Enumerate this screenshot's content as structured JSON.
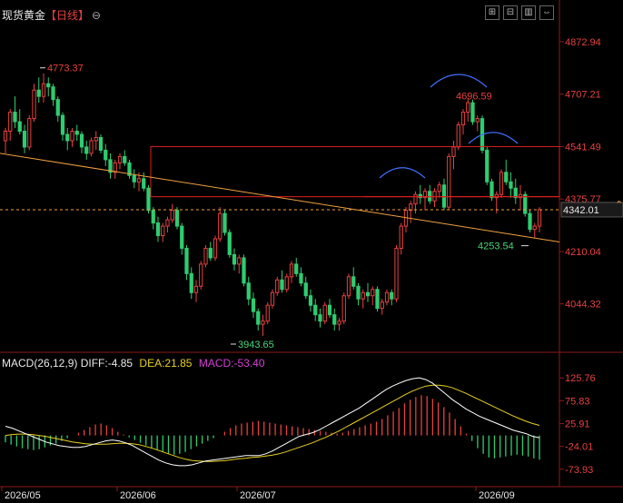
{
  "header": {
    "title": "现货黄金",
    "period": "【日线】",
    "circle_symbol": "⊖",
    "toolbar_icons": [
      "grid-plus-icon",
      "grid-minus-icon",
      "chart-split-icon",
      "arrows-icon"
    ]
  },
  "price_axis": {
    "ticks": [
      4872.94,
      4707.21,
      4541.49,
      4375.77,
      4210.04,
      4044.32
    ],
    "current_price": "4342.01",
    "range": [
      3900,
      4930
    ]
  },
  "annotations": {
    "high_left": "4773.37",
    "high_right": "4696.59",
    "low": "3943.65",
    "low_right": "4253.54"
  },
  "macd": {
    "label": "MACD(26,12,9)",
    "diff_label": "DIFF:-4.85",
    "dea_label": "DEA:21.85",
    "macd_label": "MACD:-53.40",
    "ticks": [
      "125.76",
      "75.83",
      "25.91",
      "-24.01",
      "-73.93"
    ],
    "tick_values": [
      125.76,
      75.83,
      25.91,
      -24.01,
      -73.93
    ],
    "range": [
      -100,
      150
    ]
  },
  "x_axis": {
    "labels": [
      "2026/05",
      "2026/06",
      "2026/07",
      "2026/09"
    ]
  },
  "colors": {
    "up": "#e84040",
    "down": "#2ecc71",
    "trendline": "#f0a040",
    "level_line": "#e02020",
    "arc": "#4070ff",
    "dea": "#e8d020",
    "diff": "#ffffff"
  },
  "chart_data": {
    "type": "candlestick",
    "title": "现货黄金【日线】",
    "y_range": [
      3900,
      4930
    ],
    "candles_ohlc": [
      [
        4560,
        4600,
        4520,
        4590
      ],
      [
        4590,
        4660,
        4560,
        4650
      ],
      [
        4650,
        4700,
        4600,
        4620
      ],
      [
        4620,
        4660,
        4580,
        4590
      ],
      [
        4590,
        4610,
        4520,
        4540
      ],
      [
        4540,
        4640,
        4530,
        4630
      ],
      [
        4630,
        4740,
        4620,
        4720
      ],
      [
        4720,
        4760,
        4680,
        4700
      ],
      [
        4700,
        4773,
        4680,
        4740
      ],
      [
        4740,
        4760,
        4700,
        4730
      ],
      [
        4730,
        4740,
        4670,
        4690
      ],
      [
        4690,
        4700,
        4620,
        4640
      ],
      [
        4640,
        4650,
        4560,
        4580
      ],
      [
        4580,
        4600,
        4530,
        4560
      ],
      [
        4560,
        4600,
        4540,
        4590
      ],
      [
        4590,
        4610,
        4560,
        4580
      ],
      [
        4580,
        4590,
        4520,
        4540
      ],
      [
        4540,
        4560,
        4500,
        4520
      ],
      [
        4520,
        4570,
        4510,
        4560
      ],
      [
        4560,
        4590,
        4530,
        4570
      ],
      [
        4570,
        4580,
        4520,
        4530
      ],
      [
        4530,
        4550,
        4480,
        4500
      ],
      [
        4500,
        4520,
        4440,
        4460
      ],
      [
        4460,
        4500,
        4440,
        4490
      ],
      [
        4490,
        4520,
        4470,
        4510
      ],
      [
        4510,
        4530,
        4480,
        4490
      ],
      [
        4490,
        4500,
        4440,
        4450
      ],
      [
        4450,
        4470,
        4410,
        4430
      ],
      [
        4430,
        4460,
        4400,
        4440
      ],
      [
        4440,
        4460,
        4400,
        4410
      ],
      [
        4410,
        4420,
        4330,
        4340
      ],
      [
        4340,
        4350,
        4280,
        4300
      ],
      [
        4300,
        4320,
        4240,
        4260
      ],
      [
        4260,
        4300,
        4240,
        4290
      ],
      [
        4290,
        4320,
        4270,
        4310
      ],
      [
        4310,
        4360,
        4300,
        4340
      ],
      [
        4340,
        4350,
        4280,
        4290
      ],
      [
        4290,
        4300,
        4200,
        4220
      ],
      [
        4220,
        4230,
        4120,
        4140
      ],
      [
        4140,
        4160,
        4060,
        4080
      ],
      [
        4080,
        4120,
        4050,
        4100
      ],
      [
        4100,
        4180,
        4090,
        4170
      ],
      [
        4170,
        4230,
        4160,
        4220
      ],
      [
        4220,
        4240,
        4180,
        4190
      ],
      [
        4190,
        4260,
        4180,
        4250
      ],
      [
        4250,
        4350,
        4240,
        4330
      ],
      [
        4330,
        4340,
        4260,
        4270
      ],
      [
        4270,
        4280,
        4190,
        4200
      ],
      [
        4200,
        4220,
        4150,
        4170
      ],
      [
        4170,
        4200,
        4140,
        4190
      ],
      [
        4190,
        4200,
        4100,
        4110
      ],
      [
        4110,
        4130,
        4040,
        4060
      ],
      [
        4060,
        4080,
        4000,
        4020
      ],
      [
        4020,
        4030,
        3960,
        3980
      ],
      [
        3980,
        4010,
        3943,
        3990
      ],
      [
        3990,
        4050,
        3980,
        4040
      ],
      [
        4040,
        4090,
        4030,
        4080
      ],
      [
        4080,
        4130,
        4070,
        4120
      ],
      [
        4120,
        4150,
        4080,
        4090
      ],
      [
        4090,
        4140,
        4080,
        4130
      ],
      [
        4130,
        4180,
        4110,
        4170
      ],
      [
        4170,
        4190,
        4130,
        4140
      ],
      [
        4140,
        4160,
        4100,
        4110
      ],
      [
        4110,
        4130,
        4060,
        4070
      ],
      [
        4070,
        4090,
        4020,
        4040
      ],
      [
        4040,
        4060,
        3990,
        4010
      ],
      [
        4010,
        4030,
        3970,
        3990
      ],
      [
        3990,
        4050,
        3980,
        4040
      ],
      [
        4040,
        4060,
        4000,
        4010
      ],
      [
        4010,
        4030,
        3960,
        3980
      ],
      [
        3980,
        4000,
        3960,
        3990
      ],
      [
        3990,
        4080,
        3980,
        4070
      ],
      [
        4070,
        4140,
        4060,
        4130
      ],
      [
        4130,
        4160,
        4090,
        4100
      ],
      [
        4100,
        4110,
        4040,
        4060
      ],
      [
        4060,
        4090,
        4030,
        4080
      ],
      [
        4080,
        4110,
        4050,
        4070
      ],
      [
        4070,
        4100,
        4040,
        4090
      ],
      [
        4090,
        4100,
        4020,
        4030
      ],
      [
        4030,
        4060,
        4010,
        4050
      ],
      [
        4050,
        4090,
        4040,
        4080
      ],
      [
        4080,
        4090,
        4040,
        4060
      ],
      [
        4060,
        4230,
        4050,
        4220
      ],
      [
        4220,
        4300,
        4200,
        4290
      ],
      [
        4290,
        4350,
        4270,
        4340
      ],
      [
        4340,
        4370,
        4300,
        4360
      ],
      [
        4360,
        4400,
        4330,
        4390
      ],
      [
        4390,
        4420,
        4360,
        4380
      ],
      [
        4380,
        4410,
        4340,
        4400
      ],
      [
        4400,
        4420,
        4360,
        4370
      ],
      [
        4370,
        4410,
        4350,
        4400
      ],
      [
        4400,
        4430,
        4380,
        4420
      ],
      [
        4420,
        4440,
        4340,
        4350
      ],
      [
        4350,
        4520,
        4340,
        4510
      ],
      [
        4510,
        4560,
        4470,
        4540
      ],
      [
        4540,
        4620,
        4530,
        4610
      ],
      [
        4610,
        4660,
        4580,
        4650
      ],
      [
        4650,
        4696,
        4620,
        4680
      ],
      [
        4680,
        4690,
        4610,
        4620
      ],
      [
        4620,
        4640,
        4590,
        4630
      ],
      [
        4630,
        4640,
        4520,
        4530
      ],
      [
        4530,
        4540,
        4420,
        4430
      ],
      [
        4430,
        4440,
        4370,
        4380
      ],
      [
        4380,
        4400,
        4330,
        4390
      ],
      [
        4390,
        4470,
        4380,
        4460
      ],
      [
        4460,
        4500,
        4420,
        4430
      ],
      [
        4430,
        4460,
        4380,
        4410
      ],
      [
        4410,
        4440,
        4360,
        4380
      ],
      [
        4380,
        4420,
        4340,
        4390
      ],
      [
        4390,
        4400,
        4320,
        4330
      ],
      [
        4330,
        4340,
        4270,
        4280
      ],
      [
        4280,
        4300,
        4254,
        4290
      ],
      [
        4290,
        4350,
        4270,
        4342
      ]
    ],
    "levels": [
      4541.49,
      4383.0
    ],
    "macd_series": {
      "hist": [
        -15,
        -20,
        -24,
        -28,
        -30,
        -32,
        -30,
        -26,
        -22,
        -18,
        -12,
        -6,
        0,
        6,
        12,
        18,
        24,
        26,
        22,
        16,
        8,
        2,
        -4,
        -10,
        -16,
        -22,
        -28,
        -32,
        -36,
        -40,
        -42,
        -40,
        -36,
        -30,
        -24,
        -18,
        -12,
        -6,
        0,
        8,
        16,
        22,
        26,
        28,
        30,
        32,
        30,
        28,
        26,
        24,
        22,
        20,
        18,
        16,
        14,
        12,
        10,
        8,
        6,
        4,
        6,
        10,
        14,
        18,
        22,
        26,
        30,
        36,
        44,
        52,
        60,
        70,
        78,
        84,
        88,
        86,
        80,
        72,
        62,
        50,
        36,
        20,
        4,
        -12,
        -28,
        -40,
        -48,
        -50,
        -48,
        -46,
        -44,
        -42,
        -44,
        -46,
        -50,
        -53
      ],
      "diff": [
        20,
        16,
        10,
        4,
        -2,
        -8,
        -14,
        -18,
        -22,
        -24,
        -26,
        -26,
        -24,
        -20,
        -16,
        -12,
        -10,
        -12,
        -16,
        -22,
        -30,
        -38,
        -46,
        -54,
        -60,
        -64,
        -66,
        -66,
        -64,
        -60,
        -56,
        -54,
        -52,
        -50,
        -48,
        -46,
        -44,
        -44,
        -44,
        -40,
        -34,
        -26,
        -18,
        -10,
        -2,
        2,
        6,
        12,
        20,
        28,
        36,
        44,
        52,
        60,
        70,
        80,
        90,
        100,
        108,
        114,
        120,
        124,
        126,
        122,
        114,
        102,
        90,
        78,
        68,
        58,
        50,
        42,
        36,
        30,
        24,
        18,
        12,
        8,
        4,
        -2,
        -5
      ],
      "dea": [
        0,
        2,
        3,
        3,
        2,
        0,
        -2,
        -5,
        -8,
        -11,
        -14,
        -16,
        -18,
        -19,
        -19,
        -19,
        -18,
        -17,
        -17,
        -18,
        -20,
        -24,
        -28,
        -33,
        -38,
        -43,
        -48,
        -52,
        -55,
        -56,
        -57,
        -57,
        -56,
        -55,
        -53,
        -51,
        -50,
        -48,
        -47,
        -45,
        -43,
        -40,
        -36,
        -31,
        -26,
        -21,
        -16,
        -10,
        -4,
        3,
        10,
        18,
        26,
        34,
        42,
        50,
        58,
        66,
        74,
        82,
        90,
        97,
        103,
        108,
        110,
        110,
        108,
        104,
        98,
        92,
        85,
        78,
        71,
        64,
        57,
        50,
        43,
        37,
        31,
        26,
        22
      ]
    }
  }
}
